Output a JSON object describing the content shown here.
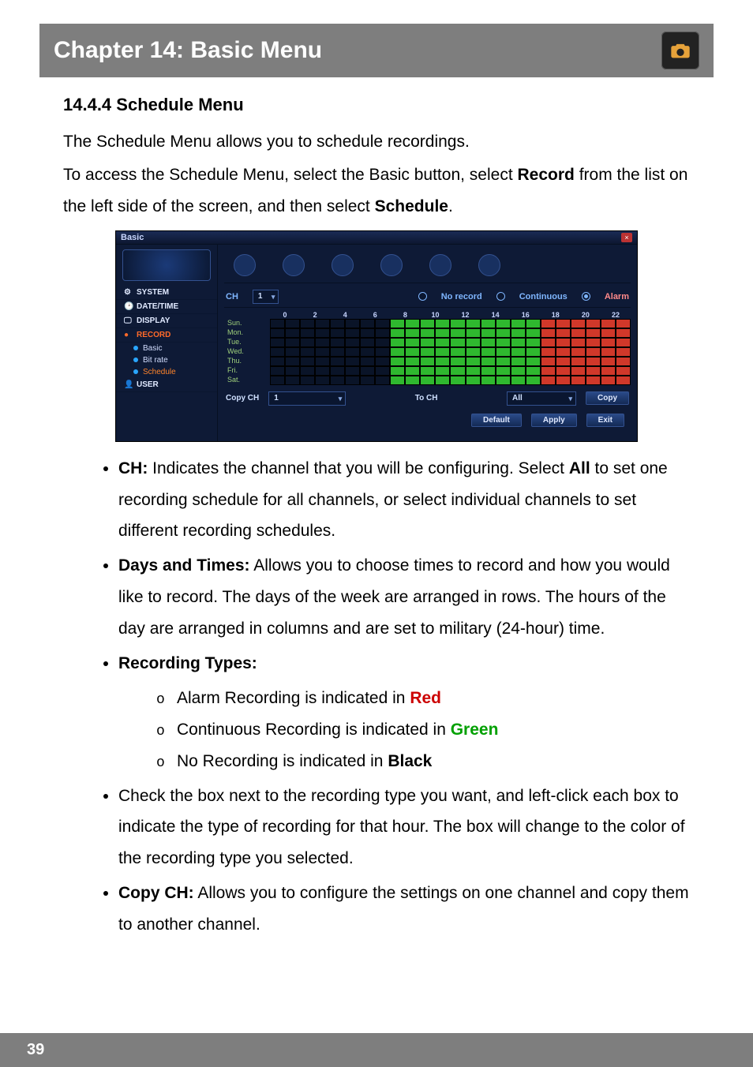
{
  "chapter_title": "Chapter 14: Basic Menu",
  "section_heading": "14.4.4 Schedule Menu",
  "intro_line": "The Schedule Menu allows you to schedule recordings.",
  "access_line_1": "To access the Schedule Menu, select the Basic button, select ",
  "access_line_bold1": "Record",
  "access_line_2": " from the list on the left side of the screen, and then select ",
  "access_line_bold2": "Schedule",
  "access_line_3": ".",
  "dvr": {
    "window_title": "Basic",
    "sidebar": {
      "items": [
        "SYSTEM",
        "DATE/TIME",
        "DISPLAY",
        "RECORD",
        "USER"
      ],
      "record_sub": [
        "Basic",
        "Bit rate",
        "Schedule"
      ]
    },
    "row1": {
      "ch_label": "CH",
      "ch_value": "1",
      "legend_norecord": "No record",
      "legend_continuous": "Continuous",
      "legend_alarm": "Alarm"
    },
    "hours": [
      "0",
      "2",
      "4",
      "6",
      "8",
      "10",
      "12",
      "14",
      "16",
      "18",
      "20",
      "22"
    ],
    "days": [
      "Sun.",
      "Mon.",
      "Tue.",
      "Wed.",
      "Thu.",
      "Fri.",
      "Sat."
    ],
    "schedule_pattern": {
      "black_cols": [
        0,
        1,
        2,
        3,
        4,
        5,
        6,
        7
      ],
      "green_cols": [
        8,
        9,
        10,
        11,
        12,
        13,
        14,
        15,
        16,
        17
      ],
      "red_cols": [
        18,
        19,
        20,
        21,
        22,
        23
      ]
    },
    "row2": {
      "copy_ch_label": "Copy CH",
      "copy_ch_value": "1",
      "to_ch_label": "To CH",
      "to_ch_value": "All",
      "copy_btn": "Copy"
    },
    "footer": {
      "default": "Default",
      "apply": "Apply",
      "exit": "Exit"
    }
  },
  "bullets": {
    "ch_label": "CH:",
    "ch_text_1": " Indicates the channel that you will be configuring. Select ",
    "ch_bold_all": "All",
    "ch_text_2": " to set one recording schedule for all channels, or select individual channels to set different recording schedules.",
    "dt_label": "Days and Times:",
    "dt_text": " Allows you to choose times to record and how you would like to record. The days of the week are arranged in rows. The hours of the day are arranged in columns and are set to military (24-hour) time.",
    "rt_label": "Recording Types:",
    "rt_alarm_pre": "Alarm Recording is indicated in ",
    "rt_alarm_color": "Red",
    "rt_cont_pre": "Continuous Recording is indicated in ",
    "rt_cont_color": "Green",
    "rt_none_pre": "No Recording is indicated in ",
    "rt_none_color": "Black",
    "check_text": "Check the box next to the recording type you want, and left-click each box to indicate the type of recording for that hour. The box will change to the color of the recording type you selected.",
    "copy_label": "Copy CH:",
    "copy_text": " Allows you to configure the settings on one channel and copy them to another channel."
  },
  "page_number": "39"
}
